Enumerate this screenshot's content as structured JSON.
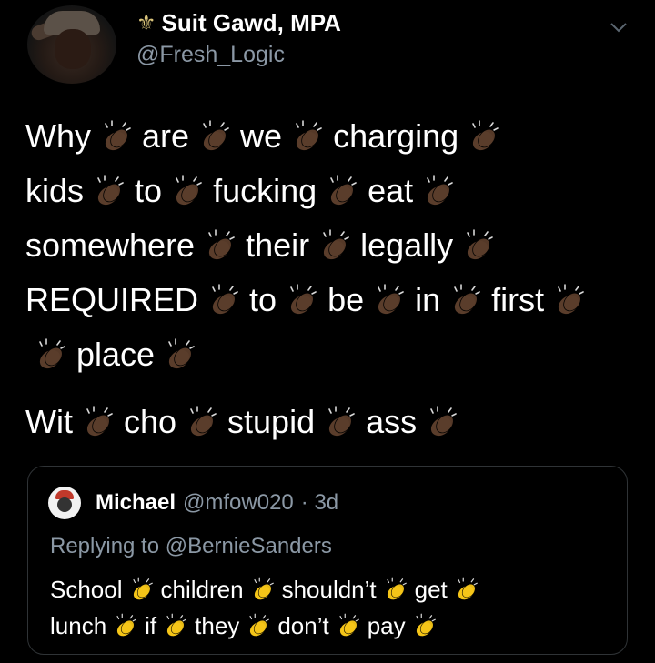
{
  "author": {
    "display_name": "Suit Gawd, MPA",
    "handle": "@Fresh_Logic",
    "name_emoji": "⚜"
  },
  "tweet": {
    "lines": [
      [
        "Why",
        "are",
        "we",
        "charging"
      ],
      [
        "kids",
        "to",
        "fucking",
        "eat"
      ],
      [
        "somewhere",
        "their",
        "legally"
      ],
      [
        "REQUIRED",
        "to",
        "be",
        "in",
        "first"
      ],
      [
        "",
        "place"
      ]
    ],
    "line2": [
      "Wit",
      "cho",
      "stupid",
      "ass"
    ],
    "clap_color": "#5a3d2b"
  },
  "quoted": {
    "name": "Michael",
    "handle": "@mfow020",
    "time": "· 3d",
    "replying": "Replying to @BernieSanders",
    "lines": [
      [
        "School",
        "children",
        "shouldn’t",
        "get"
      ],
      [
        "lunch",
        "if",
        "they",
        "don’t",
        "pay"
      ]
    ],
    "clap_color": "#f5c518"
  }
}
